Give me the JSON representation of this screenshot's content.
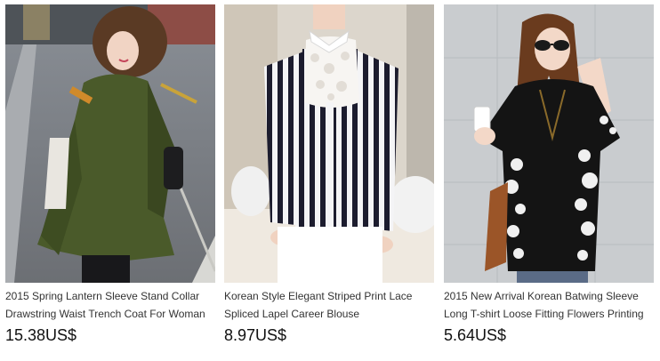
{
  "products": [
    {
      "title_line1": "2015 Spring Lantern Sleeve Stand Collar",
      "title_line2": "Drawstring Waist Trench Coat For Woman",
      "price": "15.38US$"
    },
    {
      "title_line1": "Korean Style Elegant Striped Print Lace",
      "title_line2": "Spliced Lapel Career Blouse",
      "price": "8.97US$"
    },
    {
      "title_line1": "2015 New Arrival Korean Batwing Sleeve",
      "title_line2": "Long T-shirt Loose Fitting Flowers Printing",
      "price": "5.64US$"
    }
  ],
  "colors": {
    "title_text": "#333333",
    "price_text": "#111111",
    "coat_green": "#4a5a2a",
    "stripe_navy": "#1c1c2e",
    "tshirt_black": "#141414"
  }
}
